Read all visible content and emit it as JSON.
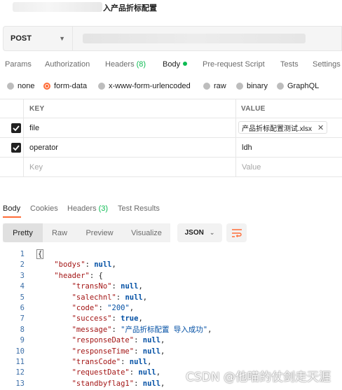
{
  "title": {
    "text": "入产品折标配置"
  },
  "request": {
    "method": "POST"
  },
  "request_tabs": [
    {
      "label": "Params"
    },
    {
      "label": "Authorization"
    },
    {
      "label": "Headers",
      "count": "(8)"
    },
    {
      "label": "Body"
    },
    {
      "label": "Pre-request Script"
    },
    {
      "label": "Tests"
    },
    {
      "label": "Settings"
    }
  ],
  "body_types": [
    "none",
    "form-data",
    "x-www-form-urlencoded",
    "raw",
    "binary",
    "GraphQL"
  ],
  "body_type_selected": "form-data",
  "kv": {
    "key_header": "KEY",
    "value_header": "VALUE",
    "rows": [
      {
        "key": "file",
        "value": "产品折标配置测试.xlsx",
        "checked": true
      },
      {
        "key": "operator",
        "value": "ldh",
        "checked": true
      }
    ],
    "placeholder_key": "Key",
    "placeholder_value": "Value"
  },
  "response_tabs": [
    {
      "label": "Body"
    },
    {
      "label": "Cookies"
    },
    {
      "label": "Headers",
      "count": "(3)"
    },
    {
      "label": "Test Results"
    }
  ],
  "view_modes": [
    "Pretty",
    "Raw",
    "Preview",
    "Visualize"
  ],
  "format": "JSON",
  "code_lines": [
    {
      "n": "1",
      "text": "{"
    },
    {
      "n": "2",
      "text": "    \"bodys\": null,"
    },
    {
      "n": "3",
      "text": "    \"header\": {"
    },
    {
      "n": "4",
      "text": "        \"transNo\": null,"
    },
    {
      "n": "5",
      "text": "        \"salechnl\": null,"
    },
    {
      "n": "6",
      "text": "        \"code\": \"200\","
    },
    {
      "n": "7",
      "text": "        \"success\": true,"
    },
    {
      "n": "8",
      "text": "        \"message\": \"产品折标配置 导入成功\","
    },
    {
      "n": "9",
      "text": "        \"responseDate\": null,"
    },
    {
      "n": "10",
      "text": "        \"responseTime\": null,"
    },
    {
      "n": "11",
      "text": "        \"transCode\": null,"
    },
    {
      "n": "12",
      "text": "        \"requestDate\": null,"
    },
    {
      "n": "13",
      "text": "        \"standbyflag1\": null,"
    }
  ],
  "watermark": "CSDN @他喵的仗剑走天涯",
  "colors": {
    "accent": "#ff6c37",
    "green": "#0cbb52"
  }
}
